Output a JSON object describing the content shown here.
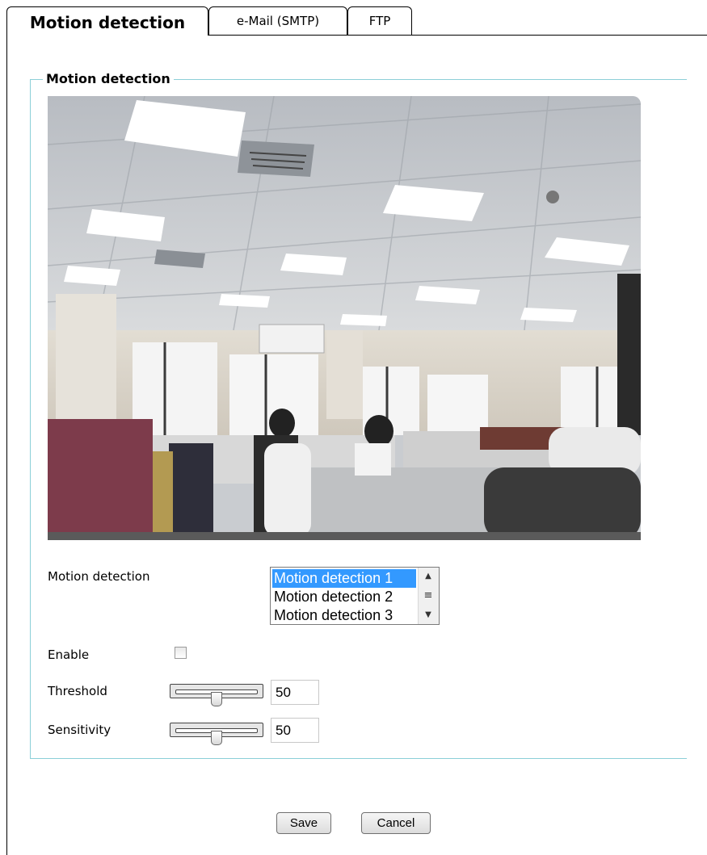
{
  "tabs": [
    {
      "label": "Motion detection",
      "active": true
    },
    {
      "label": "e-Mail (SMTP)",
      "active": false
    },
    {
      "label": "FTP",
      "active": false
    }
  ],
  "section": {
    "legend": "Motion detection"
  },
  "form": {
    "motion_detection_label": "Motion detection",
    "motion_options": [
      "Motion detection 1",
      "Motion detection 2",
      "Motion detection 3"
    ],
    "selected_option": "Motion detection 1",
    "enable_label": "Enable",
    "enable_checked": false,
    "threshold_label": "Threshold",
    "threshold_value": "50",
    "sensitivity_label": "Sensitivity",
    "sensitivity_value": "50"
  },
  "buttons": {
    "save": "Save",
    "cancel": "Cancel"
  },
  "colors": {
    "fieldset_border": "#8ccfd8",
    "selection": "#3399ff"
  }
}
